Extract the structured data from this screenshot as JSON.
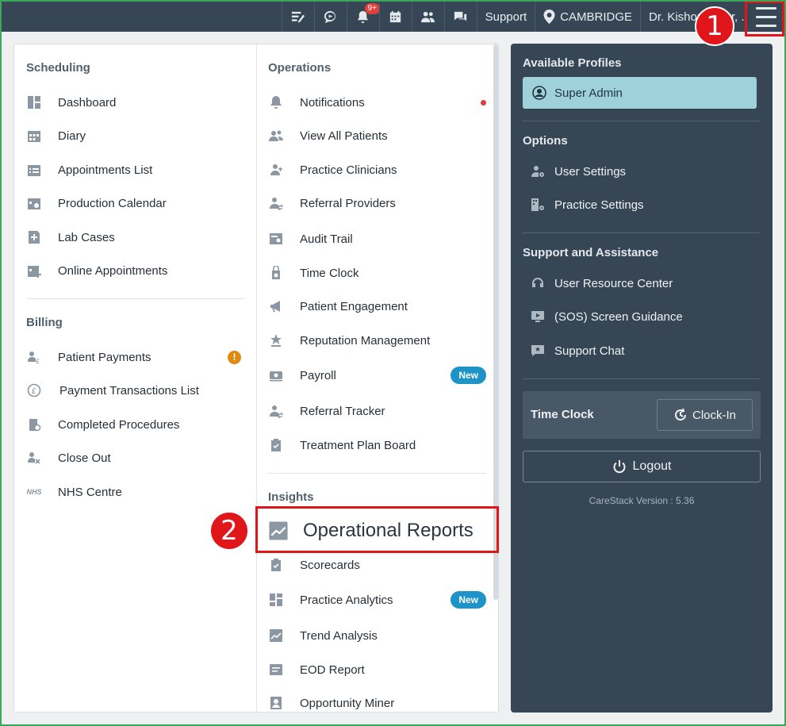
{
  "topbar": {
    "notification_badge": "9+",
    "support_label": "Support",
    "location_label": "CAMBRIDGE",
    "user_label": "Dr. Kishor",
    "user_label_tail": "r, ."
  },
  "annotations": {
    "step1": "1",
    "step2": "2"
  },
  "scheduling": {
    "title": "Scheduling",
    "items": [
      "Dashboard",
      "Diary",
      "Appointments List",
      "Production Calendar",
      "Lab Cases",
      "Online Appointments"
    ]
  },
  "billing": {
    "title": "Billing",
    "items": [
      "Patient Payments",
      "Payment Transactions List",
      "Completed Procedures",
      "Close Out",
      "NHS Centre"
    ],
    "warn_badge": "!",
    "nhs_icon_text": "NHS"
  },
  "operations": {
    "title": "Operations",
    "items": [
      "Notifications",
      "View All Patients",
      "Practice Clinicians",
      "Referral Providers",
      "Audit Trail",
      "Time Clock",
      "Patient Engagement",
      "Reputation Management",
      "Payroll",
      "Referral Tracker",
      "Treatment Plan Board"
    ],
    "new_badge": "New"
  },
  "insights": {
    "title": "Insights",
    "highlighted_item": "Operational Reports",
    "items": [
      "Scorecards",
      "Practice Analytics",
      "Trend Analysis",
      "EOD Report",
      "Opportunity Miner"
    ],
    "new_badge": "New"
  },
  "profiles": {
    "title": "Available Profiles",
    "selected": "Super Admin"
  },
  "options": {
    "title": "Options",
    "items": [
      "User Settings",
      "Practice Settings"
    ]
  },
  "support": {
    "title": "Support and Assistance",
    "items": [
      "User Resource Center",
      "(SOS) Screen Guidance",
      "Support Chat"
    ]
  },
  "time_clock": {
    "label": "Time Clock",
    "button": "Clock-In"
  },
  "logout": {
    "label": "Logout"
  },
  "version": "CareStack Version : 5.36",
  "colors": {
    "topbar": "#364655",
    "dark_panel": "#364655",
    "profile_highlight": "#9ed1da",
    "new_badge": "#1d93c8",
    "annotation_red": "#e0161b",
    "warning": "#e08a13"
  }
}
